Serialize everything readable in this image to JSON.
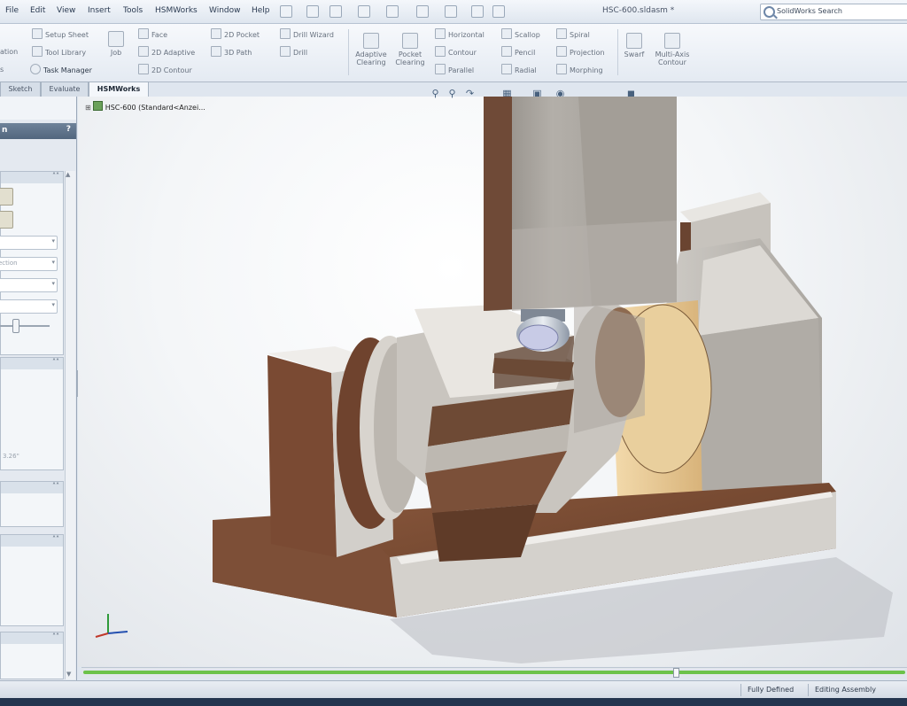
{
  "menubar": {
    "items": [
      "File",
      "Edit",
      "View",
      "Insert",
      "Tools",
      "HSMWorks",
      "Window",
      "Help"
    ],
    "document_title": "HSC-600.sldasm *",
    "search_placeholder": "SolidWorks Search"
  },
  "ribbon": {
    "col1": [
      "Setup Sheet",
      "Tool Library",
      "Task Manager"
    ],
    "col1_partial": [
      "ation",
      "s"
    ],
    "job": "Job",
    "col2": [
      "Face",
      "2D Adaptive",
      "2D Contour"
    ],
    "col3": [
      "2D Pocket",
      "3D Path"
    ],
    "col4": [
      "Drill Wizard",
      "Drill"
    ],
    "big": [
      "Adaptive\nClearing",
      "Pocket\nClearing"
    ],
    "col5": [
      "Horizontal",
      "Contour",
      "Parallel"
    ],
    "col6": [
      "Scallop",
      "Pencil",
      "Radial"
    ],
    "col7": [
      "Spiral",
      "Projection",
      "Morphing"
    ],
    "big2": [
      "Swarf",
      "Multi-Axis\nContour"
    ]
  },
  "tabs": [
    "Sketch",
    "Evaluate",
    "HSMWorks"
  ],
  "tabs_active": 2,
  "left_pane": {
    "header": "n",
    "help": "?",
    "combos": [
      "",
      "ection",
      "",
      ""
    ],
    "partial_note": "3.26\""
  },
  "viewport": {
    "tree_root": "HSC-600  (Standard<Anzei..."
  },
  "progress": {
    "fill_fraction": 0.72
  },
  "status": {
    "fully_defined": "Fully Defined",
    "editing": "Editing Assembly"
  },
  "colors": {
    "accent_green": "#6cc24a",
    "pane_header": "#5e728a",
    "model_gray": "#c9c6c1",
    "model_brown": "#7a4b33"
  }
}
